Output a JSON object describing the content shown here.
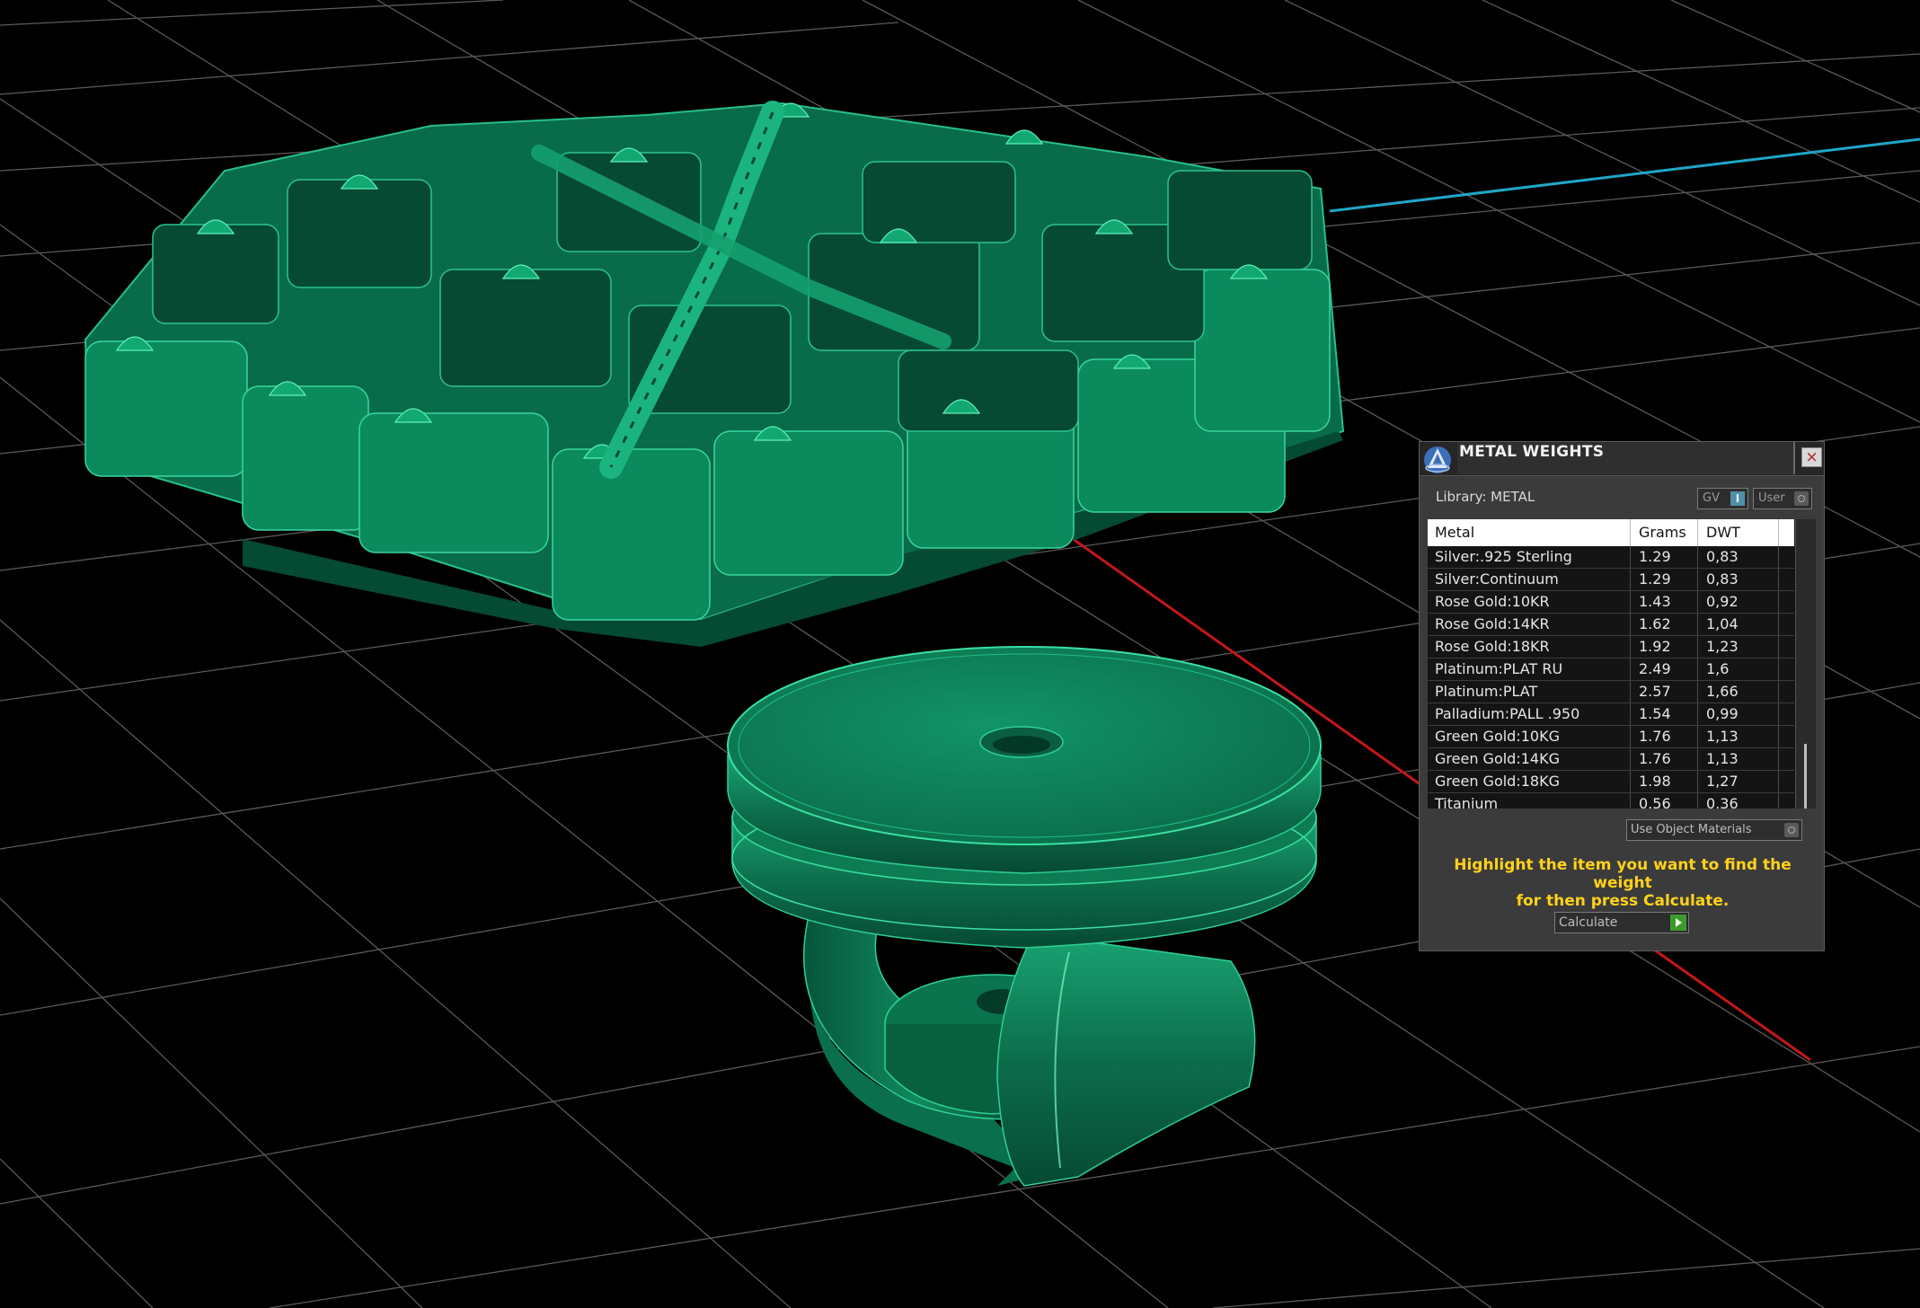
{
  "panel": {
    "title": "METAL WEIGHTS",
    "close_label": "×",
    "library_label": "Library: METAL",
    "gv_toggle_label": "GV",
    "gv_toggle_state": "I",
    "user_toggle_label": "User",
    "table": {
      "headers": [
        "Metal",
        "Grams",
        "DWT"
      ],
      "rows": [
        {
          "metal": "Silver:.925 Sterling",
          "grams": "1.29",
          "dwt": "0,83"
        },
        {
          "metal": "Silver:Continuum",
          "grams": "1.29",
          "dwt": "0,83"
        },
        {
          "metal": "Rose Gold:10KR",
          "grams": "1.43",
          "dwt": "0,92"
        },
        {
          "metal": "Rose Gold:14KR",
          "grams": "1.62",
          "dwt": "1,04"
        },
        {
          "metal": "Rose Gold:18KR",
          "grams": "1.92",
          "dwt": "1,23"
        },
        {
          "metal": "Platinum:PLAT RU",
          "grams": "2.49",
          "dwt": "1,6"
        },
        {
          "metal": "Platinum:PLAT",
          "grams": "2.57",
          "dwt": "1,66"
        },
        {
          "metal": "Palladium:PALL .950",
          "grams": "1.54",
          "dwt": "0,99"
        },
        {
          "metal": "Green Gold:10KG",
          "grams": "1.76",
          "dwt": "1,13"
        },
        {
          "metal": "Green Gold:14KG",
          "grams": "1.76",
          "dwt": "1,13"
        },
        {
          "metal": "Green Gold:18KG",
          "grams": "1.98",
          "dwt": "1,27"
        },
        {
          "metal": "Titanium",
          "grams": "0.56",
          "dwt": "0,36"
        }
      ]
    },
    "use_object_materials_label": "Use Object Materials",
    "hint_line1": "Highlight the item you want to find the weight",
    "hint_line2": "for then press Calculate.",
    "calculate_label": "Calculate"
  },
  "colors": {
    "model_green": "#0f7a55",
    "grid_line": "#7a7a7a",
    "axis_red": "#c41818",
    "axis_cyan": "#1fa7c9",
    "hint_yellow": "#ffd21a"
  }
}
